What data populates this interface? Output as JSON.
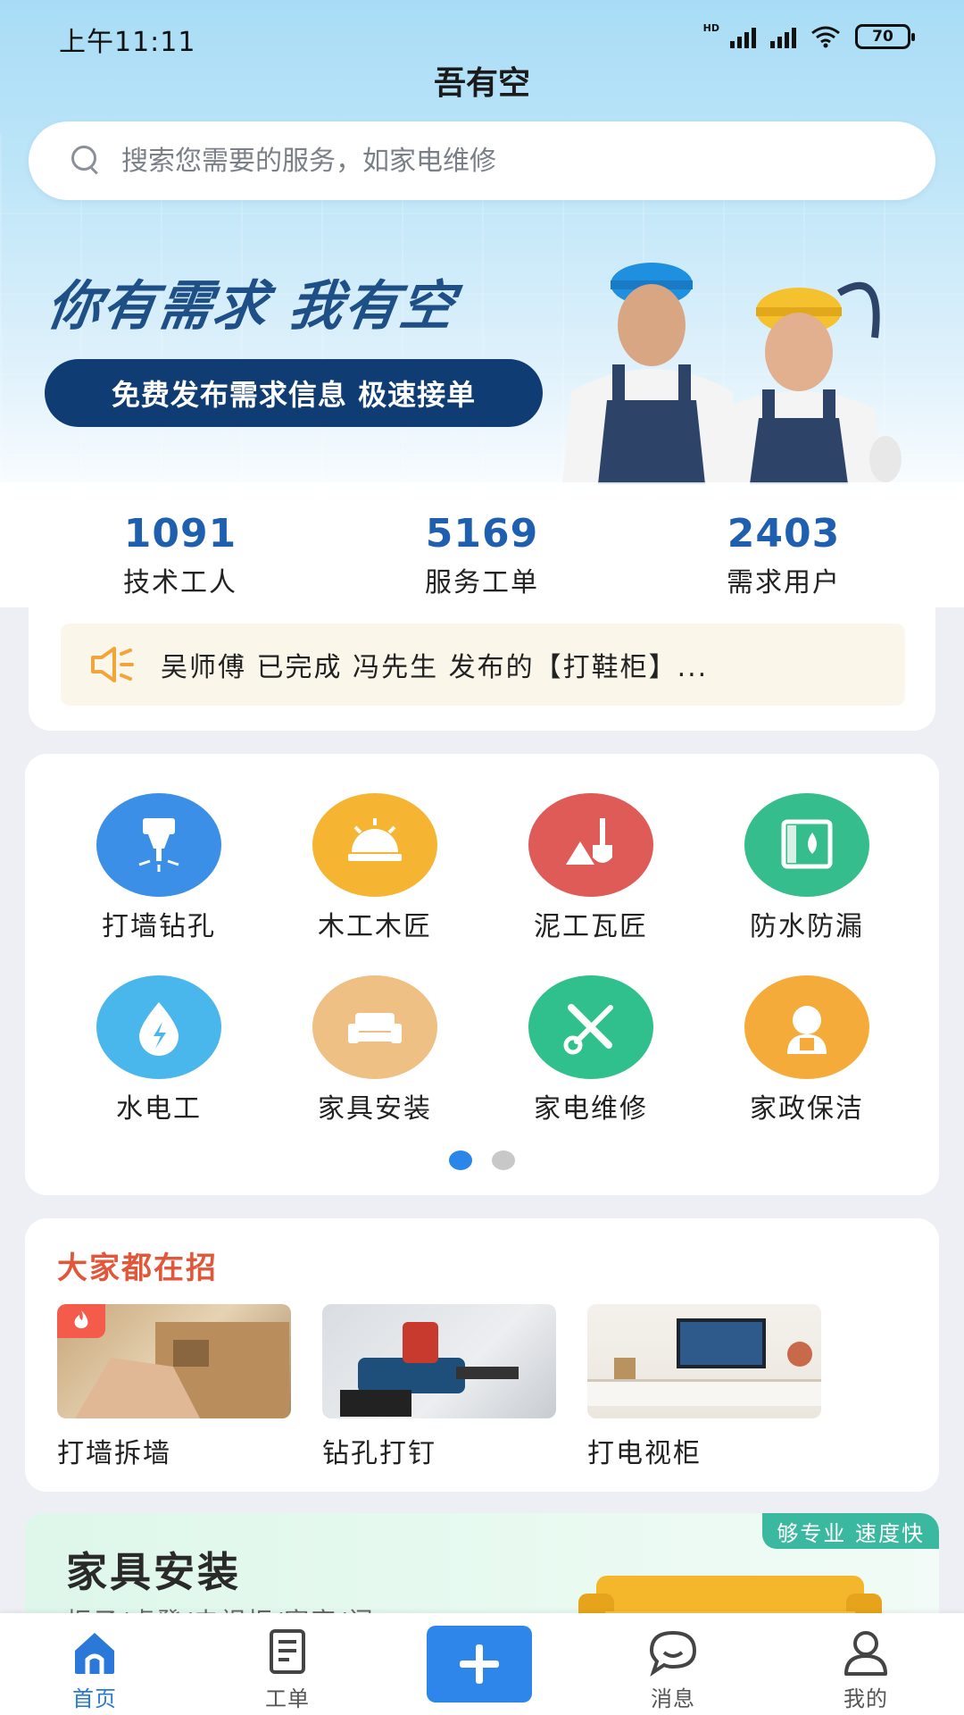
{
  "status_bar": {
    "time": "上午11:11",
    "network_label": "HD",
    "battery": "70"
  },
  "header": {
    "title": "吾有空"
  },
  "search": {
    "placeholder": "搜索您需要的服务，如家电维修",
    "value": ""
  },
  "banner": {
    "slogan": "你有需求 我有空",
    "pill": "免费发布需求信息 极速接单"
  },
  "stats": [
    {
      "value": "1091",
      "label": "技术工人"
    },
    {
      "value": "5169",
      "label": "服务工单"
    },
    {
      "value": "2403",
      "label": "需求用户"
    }
  ],
  "notice": {
    "icon": "speaker-icon",
    "text": "吴师傅 已完成 冯先生 发布的【打鞋柜】..."
  },
  "categories": [
    {
      "label": "打墙钻孔",
      "icon": "drill-icon",
      "color": "#3b8fe6"
    },
    {
      "label": "木工木匠",
      "icon": "saw-icon",
      "color": "#f5b533"
    },
    {
      "label": "泥工瓦匠",
      "icon": "trowel-icon",
      "color": "#df5b57"
    },
    {
      "label": "防水防漏",
      "icon": "waterproof-icon",
      "color": "#36bd8e"
    },
    {
      "label": "水电工",
      "icon": "water-electric-icon",
      "color": "#4ab7ec"
    },
    {
      "label": "家具安装",
      "icon": "sofa-icon",
      "color": "#eec083"
    },
    {
      "label": "家电维修",
      "icon": "tools-icon",
      "color": "#2fc08d"
    },
    {
      "label": "家政保洁",
      "icon": "housekeeper-icon",
      "color": "#f5ab3a"
    }
  ],
  "pager": {
    "pages": 2,
    "active": 0
  },
  "popular": {
    "title": "大家都在招",
    "items": [
      {
        "label": "打墙拆墙",
        "hot": true
      },
      {
        "label": "钻孔打钉",
        "hot": false
      },
      {
        "label": "打电视柜",
        "hot": false
      }
    ]
  },
  "promo": {
    "title": "家具安装",
    "subtitle": "柜子/桌凳/电视柜/窗帘/门",
    "tag": "够专业 速度快"
  },
  "tabbar": {
    "items": [
      {
        "label": "首页",
        "icon": "home-icon",
        "active": true
      },
      {
        "label": "工单",
        "icon": "order-icon",
        "active": false
      },
      {
        "label": "",
        "icon": "plus-icon",
        "active": false
      },
      {
        "label": "消息",
        "icon": "message-icon",
        "active": false
      },
      {
        "label": "我的",
        "icon": "profile-icon",
        "active": false
      }
    ]
  },
  "colors": {
    "accent": "#2f86ea",
    "stat_number": "#1f5fb0",
    "popular_title": "#e2573a"
  }
}
